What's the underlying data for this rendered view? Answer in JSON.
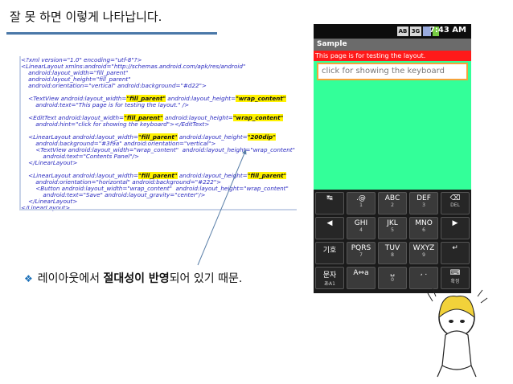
{
  "slide": {
    "title": "잘 못 하면 이렇게 나타납니다.",
    "bullet_prefix": "레이아웃에서 ",
    "bullet_bold": "절대성이 반영",
    "bullet_suffix": "되어 있기 때문."
  },
  "code_lines": [
    {
      "parts": [
        {
          "t": "<?xml version=\"1.0\" encoding=\"utf-8\"?>"
        }
      ]
    },
    {
      "parts": [
        {
          "t": "<LinearLayout xmlns:android=\"http://schemas.android.com/apk/res/android\""
        }
      ]
    },
    {
      "parts": [
        {
          "t": "    android:layout_width=\"fill_parent\""
        }
      ]
    },
    {
      "parts": [
        {
          "t": "    android:layout_height=\"fill_parent\""
        }
      ]
    },
    {
      "parts": [
        {
          "t": "    android:orientation=\"vertical\" android:background=\"#d22\">"
        }
      ]
    },
    {
      "parts": [
        {
          "t": ""
        }
      ]
    },
    {
      "parts": [
        {
          "t": "    <TextView android:layout_width="
        },
        {
          "t": "\"fill_parent\"",
          "hl": true
        },
        {
          "t": " android:layout_height="
        },
        {
          "t": "\"wrap_content\"",
          "hl": true
        }
      ]
    },
    {
      "parts": [
        {
          "t": "        android:text=\"This page is for testing the layout.\" />"
        }
      ]
    },
    {
      "parts": [
        {
          "t": ""
        }
      ]
    },
    {
      "parts": [
        {
          "t": "    <EditText android:layout_width="
        },
        {
          "t": "\"fill_parent\"",
          "hl": true
        },
        {
          "t": " android:layout_height="
        },
        {
          "t": "\"wrap_content\"",
          "hl": true
        }
      ]
    },
    {
      "parts": [
        {
          "t": "        android:hint=\"click for showing the keyboard\"></EditText>"
        }
      ]
    },
    {
      "parts": [
        {
          "t": ""
        }
      ]
    },
    {
      "parts": [
        {
          "t": "    <LinearLayout android:layout_width="
        },
        {
          "t": "\"fill_parent\"",
          "hl": true
        },
        {
          "t": " android:layout_height="
        },
        {
          "t": "\"200dip\"",
          "hl": true
        }
      ]
    },
    {
      "parts": [
        {
          "t": "        android:background=\"#3f9a\" android:orientation=\"vertical\">"
        }
      ]
    },
    {
      "parts": [
        {
          "t": "        <TextView android:layout_width=\"wrap_content\"  android:layout_height=\"wrap_content\""
        }
      ]
    },
    {
      "parts": [
        {
          "t": "            android:text=\"Contents Panel\"/>"
        }
      ]
    },
    {
      "parts": [
        {
          "t": "    </LinearLayout>"
        }
      ]
    },
    {
      "parts": [
        {
          "t": ""
        }
      ]
    },
    {
      "parts": [
        {
          "t": "    <LinearLayout android:layout_width="
        },
        {
          "t": "\"fill_parent\"",
          "hl": true
        },
        {
          "t": " android:layout_height="
        },
        {
          "t": "\"fill_parent\"",
          "hl": true
        }
      ]
    },
    {
      "parts": [
        {
          "t": "        android:orientation=\"horizontal\" android:background=\"#222\">"
        }
      ]
    },
    {
      "parts": [
        {
          "t": "        <Button android:layout_width=\"wrap_content\"  android:layout_height=\"wrap_content\""
        }
      ]
    },
    {
      "parts": [
        {
          "t": "            android:text=\"Save\" android:layout_gravity=\"center\"/>"
        }
      ]
    },
    {
      "parts": [
        {
          "t": "    </LinearLayout>"
        }
      ]
    },
    {
      "parts": [
        {
          "t": "</LinearLayout>"
        }
      ]
    }
  ],
  "phone": {
    "status_icons": [
      "AB",
      "3G"
    ],
    "clock": "7:43 AM",
    "app_title": "Sample",
    "red_text": "This page is for testing the layout.",
    "edit_hint": "click for showing the keyboard",
    "keys": [
      [
        {
          "main": "↹",
          "sub": "",
          "dark": true
        },
        {
          "main": ".@",
          "sub": "1"
        },
        {
          "main": "ABC",
          "sub": "2"
        },
        {
          "main": "DEF",
          "sub": "3"
        },
        {
          "main": "⌫",
          "sub": "DEL",
          "dark": true
        }
      ],
      [
        {
          "main": "◀",
          "sub": "",
          "dark": true
        },
        {
          "main": "GHI",
          "sub": "4"
        },
        {
          "main": "JKL",
          "sub": "5"
        },
        {
          "main": "MNO",
          "sub": "6"
        },
        {
          "main": "▶",
          "sub": "",
          "dark": true
        }
      ],
      [
        {
          "main": "기호",
          "sub": "",
          "dark": true
        },
        {
          "main": "PQRS",
          "sub": "7"
        },
        {
          "main": "TUV",
          "sub": "8"
        },
        {
          "main": "WXYZ",
          "sub": "9"
        },
        {
          "main": "↵",
          "sub": "",
          "dark": true
        }
      ],
      [
        {
          "main": "문자",
          "sub": "あA1",
          "dark": true
        },
        {
          "main": "A⇔a",
          "sub": ""
        },
        {
          "main": "␣",
          "sub": "0"
        },
        {
          "main": ", .",
          "sub": ""
        },
        {
          "main": "⌨",
          "sub": "확정",
          "dark": true
        }
      ]
    ]
  }
}
